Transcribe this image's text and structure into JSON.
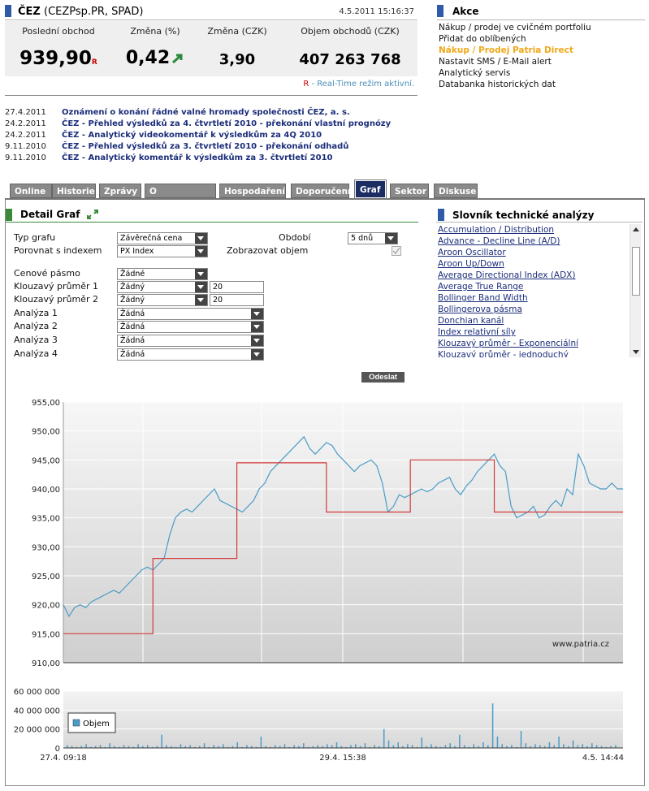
{
  "quote": {
    "ticker": "ČEZ",
    "ticker_detail": "(CEZPsp.PR, SPAD)",
    "timestamp": "4.5.2011 15:16:37",
    "labels": {
      "last": "Poslední obchod",
      "change_pct": "Změna (%)",
      "change_czk": "Změna (CZK)",
      "volume": "Objem obchodů (CZK)"
    },
    "values": {
      "last": "939,90",
      "last_flag": "R",
      "change_pct": "0,42",
      "change_czk": "3,90",
      "volume": "407 263 768"
    },
    "realtime_flag": "R",
    "realtime_text": "- Real-Time režim aktivní."
  },
  "actions": {
    "title": "Akce",
    "items": [
      {
        "label": "Nákup / prodej ve cvičném portfoliu",
        "highlight": false
      },
      {
        "label": "Přidat do oblíbených",
        "highlight": false
      },
      {
        "label": "Nákup / Prodej Patria Direct",
        "highlight": true
      },
      {
        "label": "Nastavit SMS / E-Mail alert",
        "highlight": false
      },
      {
        "label": "Analytický servis",
        "highlight": false
      },
      {
        "label": "Databanka historických dat",
        "highlight": false
      }
    ]
  },
  "news": [
    {
      "date": "27.4.2011",
      "title": "Oznámení o konání řádné valné hromady společnosti ČEZ, a. s."
    },
    {
      "date": "24.2.2011",
      "title": "ČEZ - Přehled výsledků za 4. čtvrtletí 2010 - překonání vlastní prognózy"
    },
    {
      "date": "24.2.2011",
      "title": "ČEZ - Analytický videokomentář k výsledkům za 4Q 2010"
    },
    {
      "date": "9.11.2010",
      "title": "ČEZ - Přehled výsledků za 3. čtvrtletí 2010 - překonání odhadů"
    },
    {
      "date": "9.11.2010",
      "title": "ČEZ - Analytický komentář k výsledkům za 3. čtvrtletí 2010"
    }
  ],
  "tabs": [
    "Online",
    "Historie",
    "Zprávy",
    "O společnosti",
    "Hospodaření",
    "Doporučení",
    "Graf",
    "Sektor",
    "Diskuse"
  ],
  "active_tab": "Graf",
  "detail": {
    "title": "Detail Graf",
    "form": {
      "typ_grafu_label": "Typ grafu",
      "typ_grafu_value": "Závěrečná cena",
      "obdobi_label": "Období",
      "obdobi_value": "5 dnů",
      "porovnat_label": "Porovnat s indexem",
      "porovnat_value": "PX Index",
      "zobrazovat_label": "Zobrazovat objem",
      "cenove_label": "Cenové pásmo",
      "cenove_value": "Žádné",
      "km1_label": "Klouzavý průměr 1",
      "km1_value": "Žádný",
      "km1_period": "20",
      "km2_label": "Klouzavý průměr 2",
      "km2_value": "Žádný",
      "km2_period": "20",
      "a1_label": "Analýza 1",
      "a1_value": "Žádná",
      "a2_label": "Analýza 2",
      "a2_value": "Žádná",
      "a3_label": "Analýza 3",
      "a3_value": "Žádná",
      "a4_label": "Analýza 4",
      "a4_value": "Žádná",
      "submit": "Odeslat"
    }
  },
  "glossary": {
    "title": "Slovník technické analýzy",
    "items": [
      "Accumulation / Distribution",
      "Advance - Decline Line (A/D)",
      "Aroon Oscillator",
      "Aroon Up/Down",
      "Average Directional Index (ADX)",
      "Average True Range",
      "Bollinger Band Width",
      "Bollingerova pásma",
      "Donchian kanál",
      "Index relativní síly",
      "Klouzavý průměr - Exponenciální",
      "Klouzavý průměr - jednoduchý"
    ]
  },
  "chart_data": [
    {
      "type": "line",
      "title": "",
      "watermark": "www.patria.cz",
      "ylim": [
        910,
        955
      ],
      "yticks": [
        "955,00",
        "950,00",
        "945,00",
        "940,00",
        "935,00",
        "930,00",
        "925,00",
        "920,00",
        "915,00",
        "910,00"
      ],
      "xlim": [
        0,
        100
      ],
      "series": [
        {
          "color": "#4a9cc8",
          "x": [
            0,
            1,
            2,
            3,
            4,
            5,
            6,
            7,
            8,
            9,
            10,
            11,
            12,
            13,
            14,
            15,
            16,
            17,
            18,
            19,
            20,
            21,
            22,
            23,
            24,
            25,
            26,
            27,
            28,
            29,
            30,
            31,
            32,
            33,
            34,
            35,
            36,
            37,
            38,
            39,
            40,
            41,
            42,
            43,
            44,
            45,
            46,
            47,
            48,
            49,
            50,
            51,
            52,
            53,
            54,
            55,
            56,
            57,
            58,
            59,
            60,
            61,
            62,
            63,
            64,
            65,
            66,
            67,
            68,
            69,
            70,
            71,
            72,
            73,
            74,
            75,
            76,
            77,
            78,
            79,
            80,
            81,
            82,
            83,
            84,
            85,
            86,
            87,
            88,
            89,
            90,
            91,
            92,
            93,
            94,
            95,
            96,
            97,
            98,
            99,
            100
          ],
          "y": [
            920,
            918,
            919.5,
            920,
            919.5,
            920.5,
            921,
            921.5,
            922,
            922.5,
            922,
            923,
            924,
            925,
            926,
            926.5,
            926,
            927,
            928,
            932,
            935,
            936,
            936.5,
            936,
            937,
            938,
            939,
            940,
            938,
            937.5,
            937,
            936.5,
            936,
            937,
            938,
            940,
            941,
            943,
            944,
            945,
            946,
            947,
            948,
            949,
            947,
            946,
            947,
            948,
            947.5,
            946,
            945,
            944,
            943,
            944,
            944.5,
            945,
            944,
            941,
            936,
            937,
            939,
            938.5,
            939,
            939.5,
            940,
            939.5,
            940,
            941,
            941.5,
            942,
            940,
            939,
            940.5,
            941.5,
            943,
            944,
            945,
            946,
            944,
            943,
            937,
            935,
            935.5,
            936,
            937,
            935,
            935.5,
            937,
            938,
            937,
            940,
            939,
            946,
            944,
            941,
            940.5,
            940,
            940,
            941,
            940,
            940
          ]
        },
        {
          "color": "#d23a3a",
          "x": [
            0,
            16,
            16,
            31,
            31,
            45,
            45,
            47,
            47,
            62,
            62,
            77,
            77,
            100
          ],
          "y": [
            915,
            915,
            928,
            928,
            944.5,
            944.5,
            944.5,
            944.5,
            936,
            936,
            945,
            945,
            936,
            936
          ]
        }
      ]
    },
    {
      "type": "bar",
      "series": [
        {
          "name": "Objem"
        }
      ],
      "ylim": [
        0,
        60000000
      ],
      "yticks": [
        "60 000 000",
        "40 000 000",
        "20 000 000",
        "0"
      ],
      "xticks": [
        "27.4. 09:18",
        "29.4. 15:38",
        "4.5. 14:44"
      ],
      "values": [
        3,
        2,
        1,
        2,
        4,
        1,
        2,
        3,
        1,
        5,
        2,
        1,
        3,
        2,
        1,
        4,
        2,
        3,
        1,
        2,
        14,
        3,
        2,
        1,
        4,
        2,
        3,
        1,
        2,
        5,
        1,
        3,
        2,
        4,
        1,
        2,
        6,
        1,
        3,
        2,
        1,
        12,
        2,
        1,
        3,
        2,
        4,
        1,
        3,
        2,
        5,
        1,
        2,
        3,
        2,
        4,
        3,
        6,
        2,
        1,
        3,
        4,
        2,
        5,
        1,
        3,
        2,
        20,
        8,
        3,
        6,
        2,
        4,
        3,
        1,
        11,
        2,
        4,
        2,
        1,
        3,
        5,
        2,
        14,
        3,
        1,
        4,
        2,
        6,
        3,
        47,
        12,
        4,
        2,
        3,
        1,
        18,
        5,
        2,
        4,
        3,
        2,
        6,
        3,
        12,
        4,
        2,
        8,
        3,
        4,
        2,
        5,
        3,
        2,
        1,
        2,
        3
      ]
    }
  ]
}
